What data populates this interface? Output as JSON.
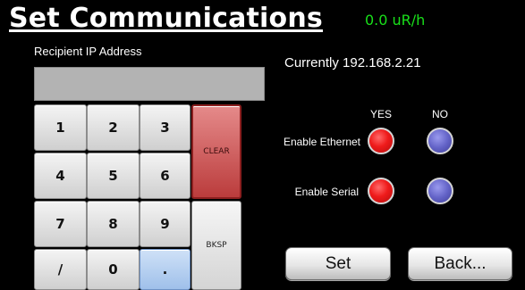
{
  "header": {
    "title": "Set Communications",
    "dose_rate": "0.0 uR/h"
  },
  "ip": {
    "label": "Recipient IP Address",
    "value": "",
    "current": "Currently 192.168.2.21"
  },
  "keypad": {
    "keys": [
      "1",
      "2",
      "3",
      "4",
      "5",
      "6",
      "7",
      "8",
      "9",
      "/",
      "0",
      "."
    ],
    "clear": "CLEAR",
    "backspace": "BKSP"
  },
  "options": {
    "yes_label": "YES",
    "no_label": "NO",
    "ethernet": {
      "label": "Enable Ethernet",
      "selected": "YES"
    },
    "serial": {
      "label": "Enable Serial",
      "selected": "YES"
    }
  },
  "colors": {
    "background": "#000000",
    "dose_rate": "#19e01a",
    "selected_radio": "#ef1b1b",
    "unselected_radio": "#6464c8",
    "clear_key": "#c94a4a",
    "dot_key": "#b4cff0"
  },
  "buttons": {
    "set": "Set",
    "back": "Back..."
  }
}
